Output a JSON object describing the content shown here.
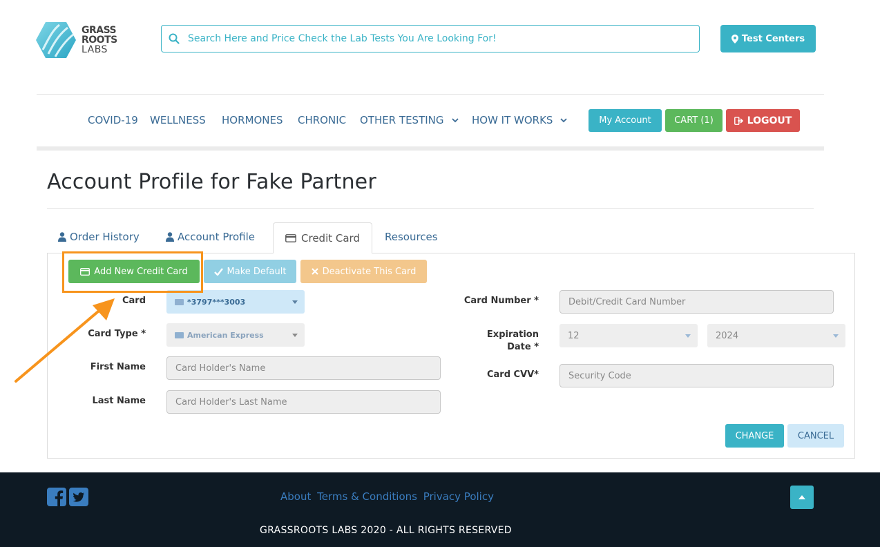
{
  "brand": {
    "line1": "GRASS",
    "line2": "ROOTS",
    "line3": "LABS"
  },
  "header": {
    "search_placeholder": "Search Here and Price Check the Lab Tests You Are Looking For!",
    "test_centers_label": "Test Centers"
  },
  "nav": {
    "items": [
      "COVID-19",
      "WELLNESS",
      "HORMONES",
      "CHRONIC",
      "OTHER TESTING",
      "HOW IT WORKS"
    ],
    "my_account": "My Account",
    "cart": "CART (1)",
    "logout": "LOGOUT"
  },
  "page": {
    "title": "Account Profile for Fake Partner"
  },
  "tabs": [
    {
      "label": "Order History",
      "icon": "user-icon"
    },
    {
      "label": "Account Profile",
      "icon": "user-icon"
    },
    {
      "label": "Credit Card",
      "icon": "credit-card-icon",
      "active": true
    },
    {
      "label": "Resources",
      "icon": ""
    }
  ],
  "actions": {
    "add_card": "Add New Credit Card",
    "make_default": "Make Default",
    "deactivate": "Deactivate This Card"
  },
  "form": {
    "card_label": "Card",
    "card_value": "*3797***3003",
    "card_type_label": "Card Type *",
    "card_type_value": "American Express",
    "first_name_label": "First Name",
    "first_name_placeholder": "Card Holder's Name",
    "last_name_label": "Last Name",
    "last_name_placeholder": "Card Holder's Last Name",
    "card_number_label": "Card Number *",
    "card_number_placeholder": "Debit/Credit Card Number",
    "expiration_label_1": "Expiration",
    "expiration_label_2": "Date *",
    "exp_month": "12",
    "exp_year": "2024",
    "cvv_label": "Card CVV*",
    "cvv_placeholder": "Security Code",
    "change": "CHANGE",
    "cancel": "CANCEL"
  },
  "footer": {
    "links": [
      "About",
      "Terms & Conditions",
      "Privacy Policy"
    ],
    "copyright": "GRASSROOTS LABS 2020 - ALL RIGHTS RESERVED"
  },
  "colors": {
    "accent": "#3ab3c6",
    "success": "#5cb85c",
    "danger": "#d9534f",
    "annotation": "#f7941d",
    "footer_bg": "#0e1a24"
  }
}
